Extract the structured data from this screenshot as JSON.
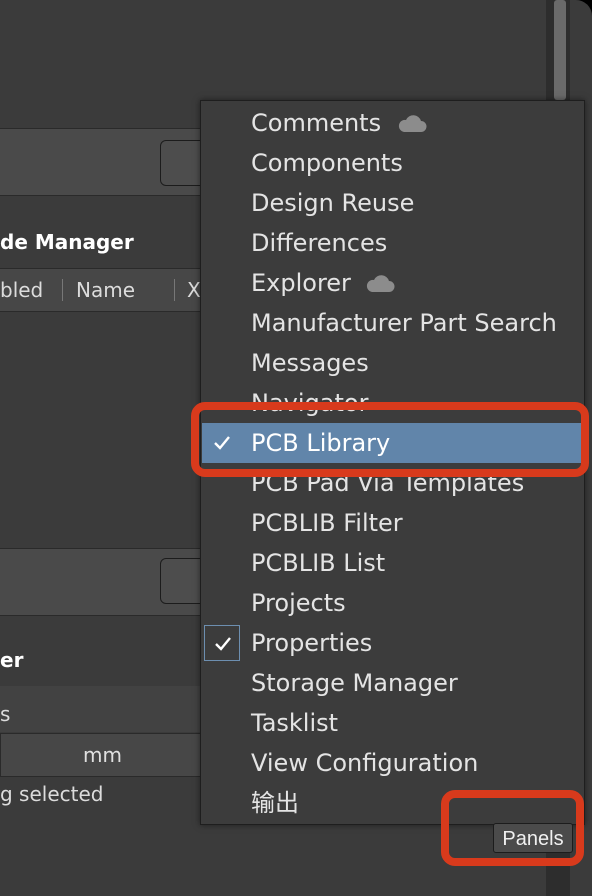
{
  "background": {
    "section1_title_fragment": "de Manager",
    "columns": [
      "bled",
      "Name",
      "X"
    ],
    "section2_title_fragment": "er",
    "section2_row_fragment": "s",
    "unit_value": "mm",
    "status_fragment": "g selected"
  },
  "menu": {
    "items": [
      {
        "label": "Comments",
        "cloud": true,
        "checked": false,
        "selected": false
      },
      {
        "label": "Components",
        "cloud": false,
        "checked": false,
        "selected": false
      },
      {
        "label": "Design Reuse",
        "cloud": false,
        "checked": false,
        "selected": false
      },
      {
        "label": "Differences",
        "cloud": false,
        "checked": false,
        "selected": false
      },
      {
        "label": "Explorer",
        "cloud": true,
        "checked": false,
        "selected": false
      },
      {
        "label": "Manufacturer Part Search",
        "cloud": false,
        "checked": false,
        "selected": false
      },
      {
        "label": "Messages",
        "cloud": false,
        "checked": false,
        "selected": false
      },
      {
        "label": "Navigator",
        "cloud": false,
        "checked": false,
        "selected": false
      },
      {
        "label": "PCB Library",
        "cloud": false,
        "checked": true,
        "selected": true
      },
      {
        "label": "PCB Pad Via Templates",
        "cloud": false,
        "checked": false,
        "selected": false
      },
      {
        "label": "PCBLIB Filter",
        "cloud": false,
        "checked": false,
        "selected": false
      },
      {
        "label": "PCBLIB List",
        "cloud": false,
        "checked": false,
        "selected": false
      },
      {
        "label": "Projects",
        "cloud": false,
        "checked": false,
        "selected": false
      },
      {
        "label": "Properties",
        "cloud": false,
        "checked": true,
        "selected": false
      },
      {
        "label": "Storage Manager",
        "cloud": false,
        "checked": false,
        "selected": false
      },
      {
        "label": "Tasklist",
        "cloud": false,
        "checked": false,
        "selected": false
      },
      {
        "label": "View Configuration",
        "cloud": false,
        "checked": false,
        "selected": false
      },
      {
        "label": "输出",
        "cloud": false,
        "checked": false,
        "selected": false
      }
    ]
  },
  "panels_button": {
    "label": "Panels"
  },
  "colors": {
    "highlight_annotation": "#d83a1c",
    "selected_item": "#6185aa",
    "menu_bg": "#3c3c3c"
  }
}
